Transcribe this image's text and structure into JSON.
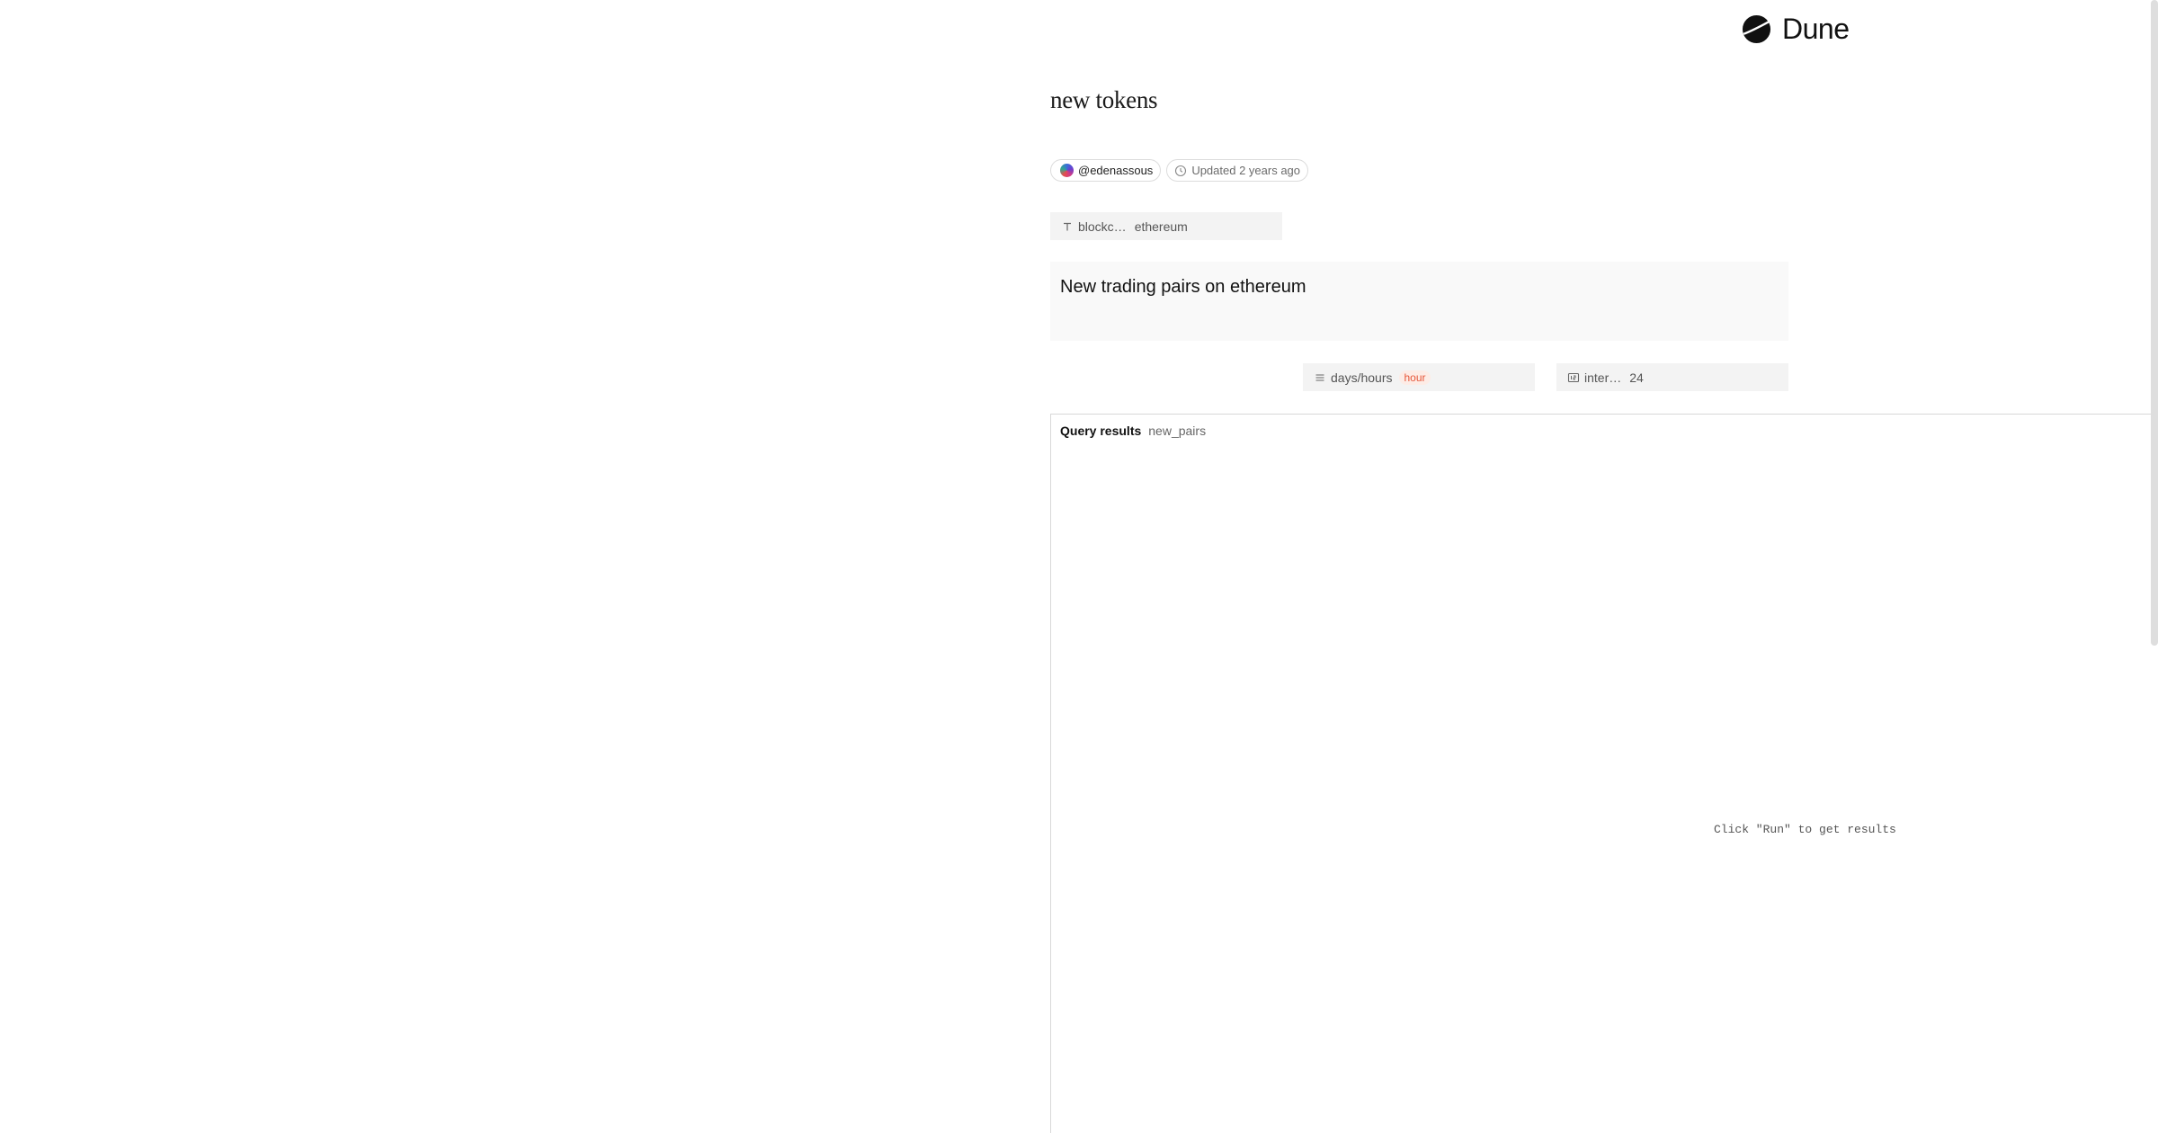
{
  "brand": {
    "name": "Dune",
    "logo_icon": "dune-logo-icon"
  },
  "dashboard": {
    "title": "new tokens",
    "author": "@edenassous",
    "updated": "Updated 2 years ago"
  },
  "params": {
    "blockchain": {
      "name": "blockc…",
      "value": "ethereum",
      "type_icon": "text-type-icon"
    },
    "days_hours": {
      "name": "days/hours",
      "value": "hour",
      "type_icon": "list-type-icon"
    },
    "interval": {
      "name": "inter…",
      "value": "24",
      "type_icon": "number-type-icon"
    }
  },
  "text_widget": {
    "heading": "New trading pairs on ethereum"
  },
  "results": {
    "label": "Query results",
    "query_name": "new_pairs",
    "empty_message": "Click \"Run\" to get results"
  },
  "colors": {
    "accent_badge": "#e6573b",
    "param_bg": "#f3f3f3",
    "widget_bg": "#f9f9f9"
  }
}
